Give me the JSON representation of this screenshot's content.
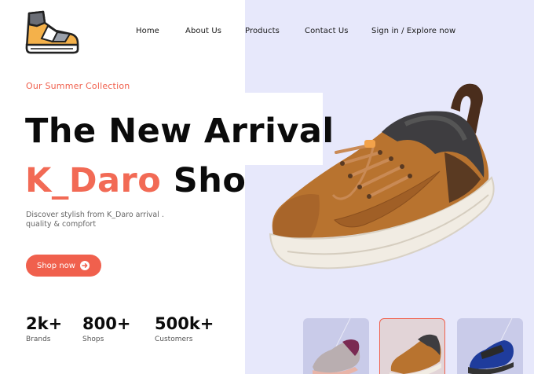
{
  "logo": {
    "icon": "sneaker-logo-icon"
  },
  "nav": {
    "items": [
      {
        "label": "Home"
      },
      {
        "label": "About Us"
      },
      {
        "label": "Products"
      },
      {
        "label": "Contact Us"
      },
      {
        "label": "Sign in / Explore now"
      }
    ]
  },
  "hero": {
    "tagline": "Our Summer Collection",
    "title_line1": "The New Arrival",
    "title_accent": "K_Daro",
    "title_rest": "Shoe",
    "description": "Discover stylish from K_Daro arrival . quality & compfort",
    "cta_label": "Shop now",
    "cta_icon": "arrow-right-circle-icon",
    "image": "brown-leather-sneaker-image"
  },
  "stats": [
    {
      "value": "2k+",
      "label": "Brands"
    },
    {
      "value": "800+",
      "label": "Shops"
    },
    {
      "value": "500k+",
      "label": "Customers"
    }
  ],
  "thumbnails": [
    {
      "name": "grey-purple-sneaker",
      "selected": false
    },
    {
      "name": "brown-sneaker",
      "selected": true
    },
    {
      "name": "blue-hiking-sneaker",
      "selected": false
    }
  ],
  "colors": {
    "accent": "#f0604d",
    "panel": "#e7e8fb",
    "text": "#0b0b0b"
  }
}
